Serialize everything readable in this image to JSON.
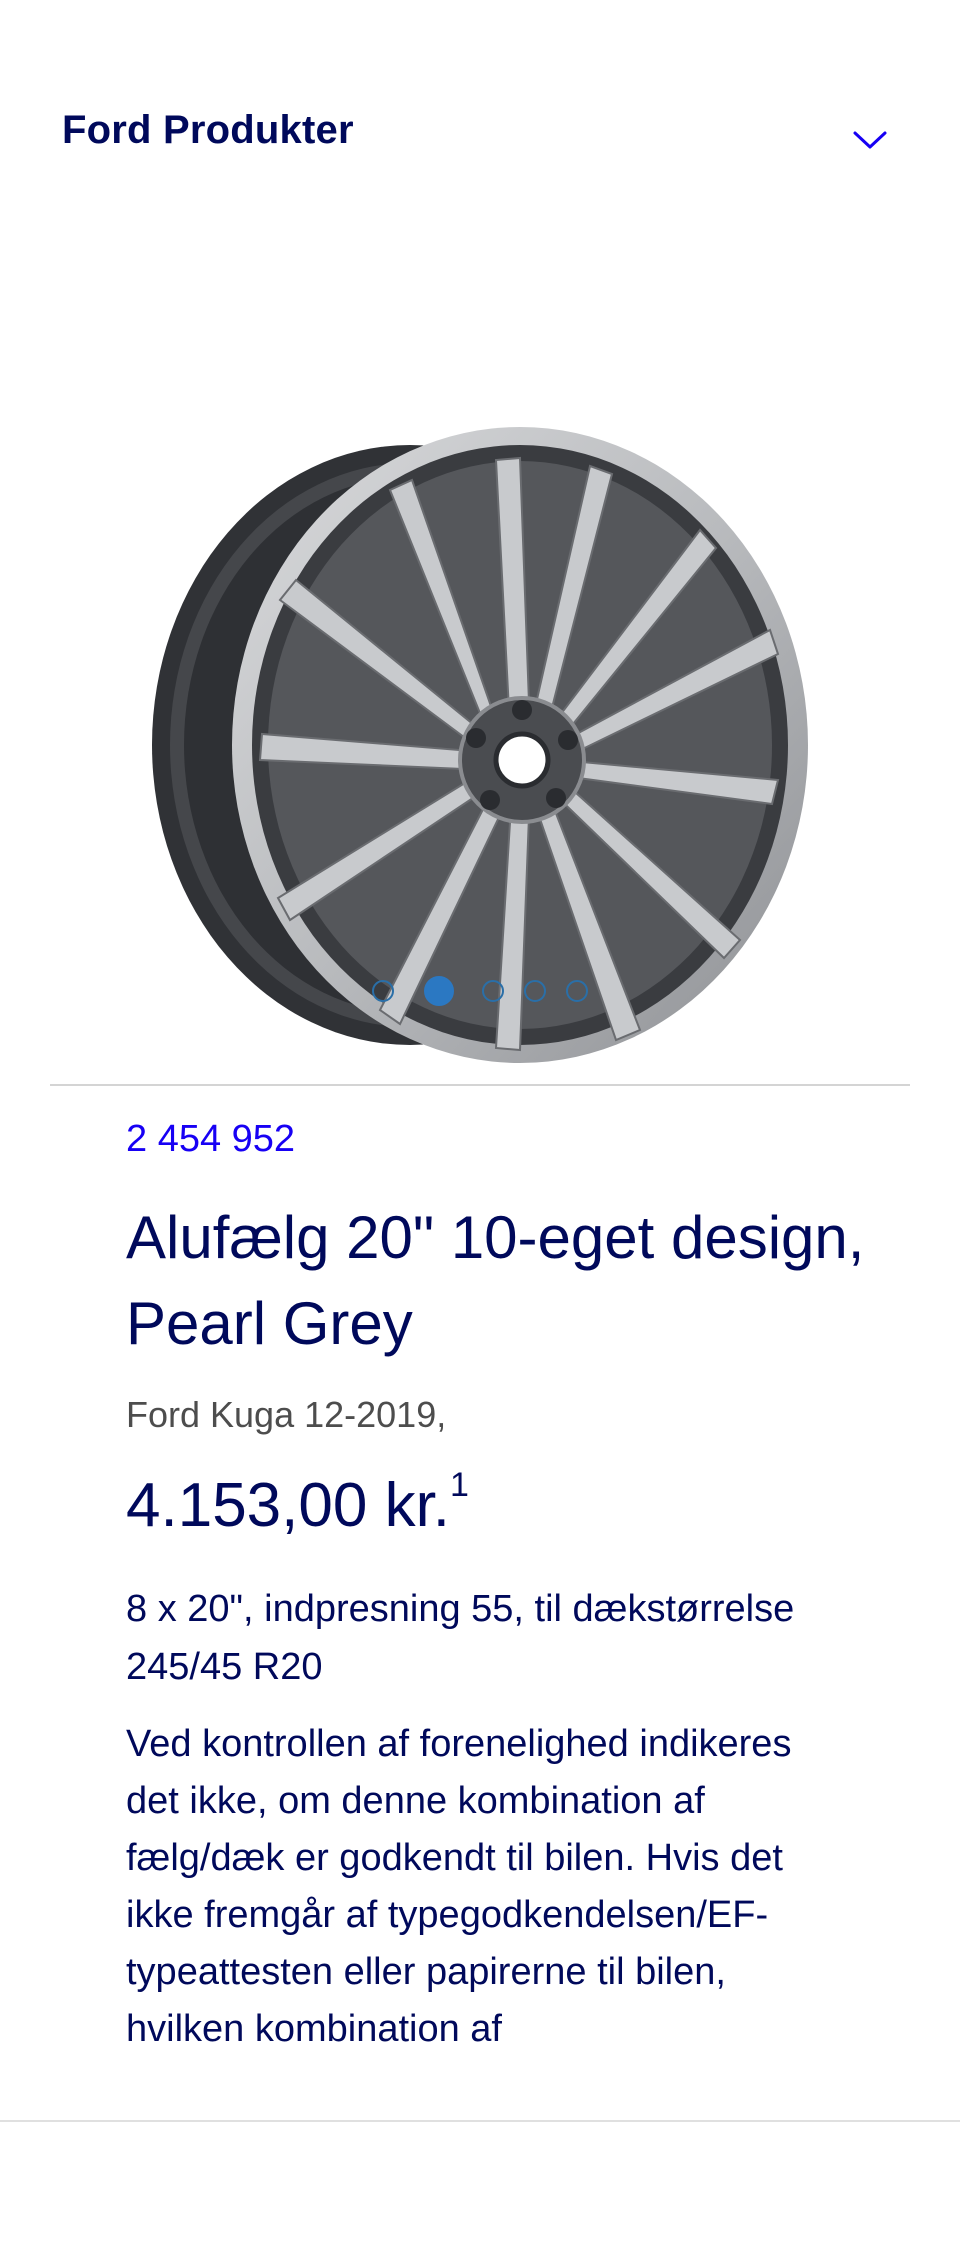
{
  "header": {
    "title": "Ford Produkter",
    "toggle_icon": "chevron-down-icon"
  },
  "gallery": {
    "image_icon": "alloy-wheel-image",
    "slide_count": 5,
    "active_slide": 2
  },
  "product": {
    "part_number": "2 454 952",
    "title": "Alufælg 20\" 10-eget design, Pearl Grey",
    "model": "Ford Kuga 12-2019,",
    "price": "4.153,00 kr.",
    "price_footnote": "1",
    "specs": "8 x 20\", indpresning 55, til dækstørrelse 245/45 R20",
    "description": "Ved kontrollen af forenelighed indikeres det ikke, om denne kombination af fælg/dæk er godkendt til bilen. Hvis det ikke fremgår af typegodkendelsen/EF-typeattesten eller papirerne til bilen, hvilken kombination af"
  },
  "colors": {
    "brand_navy": "#00095b",
    "link_blue": "#1700f4",
    "dot_blue": "#2b78c2",
    "muted_text": "#4d4d4d"
  }
}
